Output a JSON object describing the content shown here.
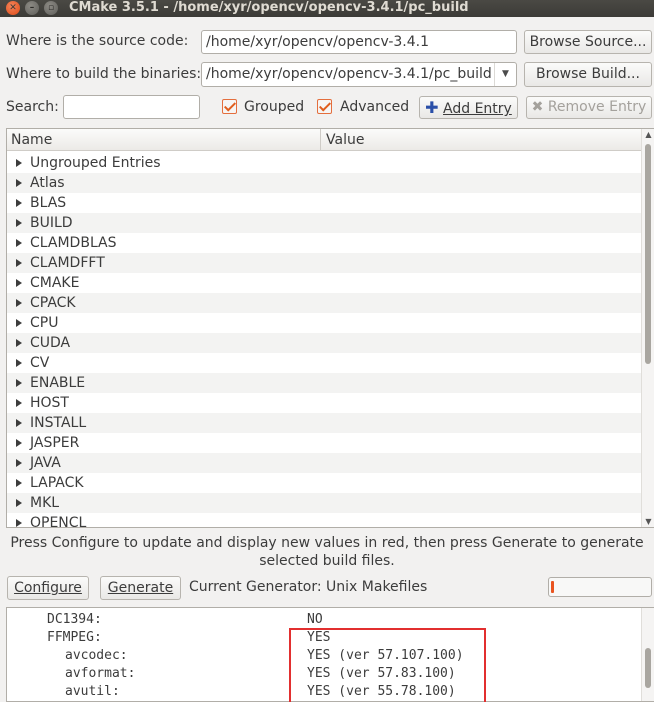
{
  "window": {
    "title": "CMake 3.5.1 - /home/xyr/opencv/opencv-3.4.1/pc_build"
  },
  "source": {
    "label": "Where is the source code:",
    "value": "/home/xyr/opencv/opencv-3.4.1",
    "browse_label": "Browse Source..."
  },
  "build": {
    "label": "Where to build the binaries:",
    "value": "/home/xyr/opencv/opencv-3.4.1/pc_build",
    "browse_label": "Browse Build..."
  },
  "toolbar": {
    "search_label": "Search:",
    "search_value": "",
    "grouped_label": "Grouped",
    "grouped_checked": true,
    "advanced_label": "Advanced",
    "advanced_checked": true,
    "add_entry_label": "Add Entry",
    "remove_entry_label": "Remove Entry",
    "accent_color": "#e05e1d"
  },
  "table": {
    "columns": [
      "Name",
      "Value"
    ],
    "rows": [
      "Ungrouped Entries",
      "Atlas",
      "BLAS",
      "BUILD",
      "CLAMDBLAS",
      "CLAMDFFT",
      "CMAKE",
      "CPACK",
      "CPU",
      "CUDA",
      "CV",
      "ENABLE",
      "HOST",
      "INSTALL",
      "JASPER",
      "JAVA",
      "LAPACK",
      "MKL",
      "OPENCL"
    ]
  },
  "status": {
    "message": "Press Configure to update and display new values in red, then press Generate to generate selected build files.",
    "configure_label": "Configure",
    "generate_label": "Generate",
    "generator_text": "Current Generator: Unix Makefiles",
    "progress": 0.01
  },
  "output": {
    "lines": [
      {
        "key": "DC1394:",
        "value": "NO"
      },
      {
        "key": "FFMPEG:",
        "value": "YES"
      },
      {
        "key": "avcodec:",
        "value": "YES (ver 57.107.100)"
      },
      {
        "key": "avformat:",
        "value": "YES (ver 57.83.100)"
      },
      {
        "key": "avutil:",
        "value": "YES (ver 55.78.100)"
      }
    ],
    "highlight_color": "#e22f2f"
  }
}
